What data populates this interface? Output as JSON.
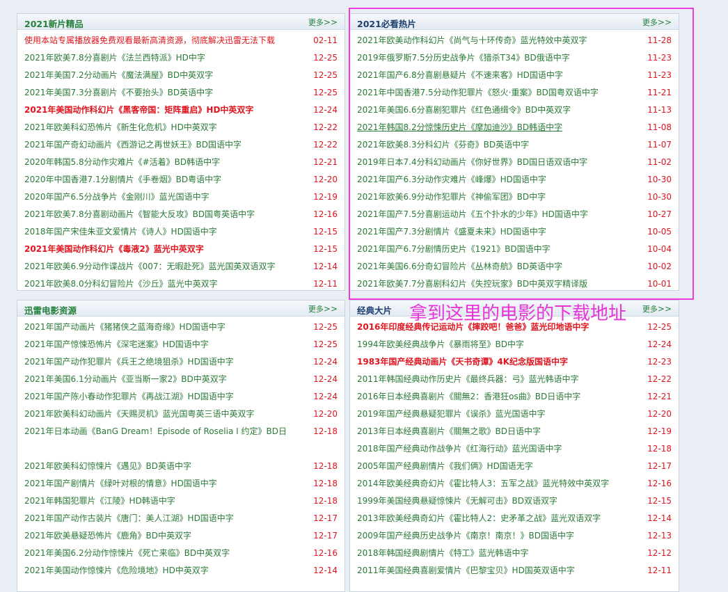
{
  "panels": {
    "new2021": {
      "title": "2021新片精品",
      "more": "更多",
      "items": [
        {
          "t": "使用本站专属播放器免费观看最新高清资源，彻底解决迅雷无法下载",
          "d": "02-11",
          "s": "red"
        },
        {
          "t": "2021年欧美7.8分喜剧片《法兰西特派》HD中字",
          "d": "12-25"
        },
        {
          "t": "2021年美国7.2分动画片《魔法满屋》BD中英双字",
          "d": "12-25"
        },
        {
          "t": "2021年美国7.3分喜剧片《不要抬头》BD英语中字",
          "d": "12-25"
        },
        {
          "t": "2021年美国动作科幻片《黑客帝国：矩阵重启》HD中英双字",
          "d": "12-24",
          "s": "bold"
        },
        {
          "t": "2021年欧美科幻恐怖片《新生化危机》HD中英双字",
          "d": "12-22"
        },
        {
          "t": "2021年国产奇幻动画片《西游记之再世妖王》BD国语中字",
          "d": "12-22"
        },
        {
          "t": "2020年韩国5.8分动作灾难片《#活着》BD韩语中字",
          "d": "12-21"
        },
        {
          "t": "2020年中国香港7.1分剧情片《手卷烟》BD粤语中字",
          "d": "12-20"
        },
        {
          "t": "2020年国产6.5分战争片《金刚川》蓝光国语中字",
          "d": "12-19"
        },
        {
          "t": "2021年欧美7.8分喜剧动画片《智能大反攻》BD国粤英语中字",
          "d": "12-16"
        },
        {
          "t": "2018年国产宋佳朱亚文爱情片《诗人》HD国语中字",
          "d": "12-15"
        },
        {
          "t": "2021年美国动作科幻片《毒液2》蓝光中英双字",
          "d": "12-15",
          "s": "bold"
        },
        {
          "t": "2021年欧美6.9分动作谍战片《007：无暇赴死》蓝光国英双语双字",
          "d": "12-14"
        },
        {
          "t": "2021年欧美8.0分科幻冒险片《沙丘》蓝光中英双字",
          "d": "12-11"
        }
      ]
    },
    "hot2021": {
      "title": "2021必看热片",
      "more": "更多",
      "items": [
        {
          "t": "2021年欧美动作科幻片《尚气与十环传奇》蓝光特效中英双字",
          "d": "11-28"
        },
        {
          "t": "2019年俄罗斯7.5分历史战争片《猎杀T34》BD俄语中字",
          "d": "11-23"
        },
        {
          "t": "2021年国产6.8分喜剧悬疑片《不速来客》HD国语中字",
          "d": "11-23"
        },
        {
          "t": "2021年中国香港7.5分动作犯罪片《怒火·重案》BD国粤双语中字",
          "d": "11-21"
        },
        {
          "t": "2021年美国6.6分喜剧犯罪片《红色通缉令》BD中英双字",
          "d": "11-13"
        },
        {
          "t": "2021年韩国8.2分惊悚历史片《摩加迪沙》BD韩语中字",
          "d": "11-08",
          "s": "u"
        },
        {
          "t": "2021年欧美8.3分科幻片《芬奇》BD英语中字",
          "d": "11-07"
        },
        {
          "t": "2019年日本7.4分科幻动画片《你好世界》BD国日语双语中字",
          "d": "11-02"
        },
        {
          "t": "2021年国产6.3分动作灾难片《峰爆》HD国语中字",
          "d": "10-30"
        },
        {
          "t": "2021年欧美6.9分动作犯罪片《神偷军团》BD中字",
          "d": "10-30"
        },
        {
          "t": "2021年国产7.5分喜剧运动片《五个扑水的少年》HD国语中字",
          "d": "10-27"
        },
        {
          "t": "2021年国产7.3分剧情片《盛夏未来》HD国语中字",
          "d": "10-05"
        },
        {
          "t": "2021年国产6.7分剧情历史片《1921》BD国语中字",
          "d": "10-04"
        },
        {
          "t": "2021年美国6.6分奇幻冒险片《丛林奇航》BD英语中字",
          "d": "10-02"
        },
        {
          "t": "2021年欧美7.7分喜剧科幻片《失控玩家》BD中英双字精译版",
          "d": "10-01"
        }
      ]
    },
    "xunlei": {
      "title": "迅雷电影资源",
      "more": "更多",
      "items": [
        {
          "t": "2021年国产动画片《猪猪侠之蓝海奇缘》HD国语中字",
          "d": "12-25"
        },
        {
          "t": "2021年国产惊悚恐怖片《深宅迷案》HD国语中字",
          "d": "12-25"
        },
        {
          "t": "2021年国产动作犯罪片《兵王之绝境狙杀》HD国语中字",
          "d": "12-24"
        },
        {
          "t": "2021年美国6.1分动画片《亚当斯一家2》BD中英双字",
          "d": "12-24"
        },
        {
          "t": "2021年国产陈小春动作犯罪片《再战江湖》HD国语中字",
          "d": "12-24"
        },
        {
          "t": "2021年欧美科幻动画片《天赐灵机》蓝光国粤英三语中英双字",
          "d": "12-20"
        },
        {
          "t": "2021年日本动画《BanG Dream！Episode of Roselia Ⅰ 约定》BD日",
          "d": "12-18",
          "s": "wrap"
        },
        {
          "t": "2021年欧美科幻惊悚片《遇见》BD英语中字",
          "d": "12-18"
        },
        {
          "t": "2021年国产剧情片《绿叶对根的情意》HD国语中字",
          "d": "12-18"
        },
        {
          "t": "2021年韩国犯罪片《江陵》HD韩语中字",
          "d": "12-18"
        },
        {
          "t": "2021年国产动作古装片《唐门：美人江湖》HD国语中字",
          "d": "12-17"
        },
        {
          "t": "2021年欧美悬疑恐怖片《鹿角》BD中英双字",
          "d": "12-17"
        },
        {
          "t": "2021年美国6.2分动作惊悚片《死亡来临》BD中英双字",
          "d": "12-16"
        },
        {
          "t": "2021年美国动作惊悚片《危险境地》HD中英双字",
          "d": "12-14"
        }
      ]
    },
    "classic": {
      "title": "经典大片",
      "more": "更多",
      "items": [
        {
          "t": "2016年印度经典传记运动片《摔跤吧！爸爸》蓝光印地语中字",
          "d": "12-25",
          "s": "bold"
        },
        {
          "t": "1994年欧美经典战争片《暴雨将至》BD中字",
          "d": "12-24"
        },
        {
          "t": "1983年国产经典动画片《天书奇谭》4K纪念版国语中字",
          "d": "12-23",
          "s": "bold"
        },
        {
          "t": "2011年韩国经典动作历史片《最终兵器：弓》蓝光韩语中字",
          "d": "12-22"
        },
        {
          "t": "2016年日本经典喜剧片《關無2：香港狂os曲》BD日语中字",
          "d": "12-21"
        },
        {
          "t": "2019年国产经典悬疑犯罪片《误杀》蓝光国语中字",
          "d": "12-20"
        },
        {
          "t": "2013年日本经典喜剧片《關無之歌》BD日语中字",
          "d": "12-19"
        },
        {
          "t": "2018年国产经典动作战争片《红海行动》蓝光国语中字",
          "d": "12-18"
        },
        {
          "t": "2005年国产经典剧情片《我们俩》HD国语无字",
          "d": "12-17"
        },
        {
          "t": "2014年欧美经典奇幻片《霍比特人3：五军之战》蓝光特效中英双字",
          "d": "12-16"
        },
        {
          "t": "1999年美国经典悬疑惊悚片《无解可击》BD双语双字",
          "d": "12-15"
        },
        {
          "t": "2013年欧美经典奇幻片《霍比特人2：史矛革之战》蓝光双语双字",
          "d": "12-14"
        },
        {
          "t": "2009年国产经典历史战争片《南京！南京！》BD国语中字",
          "d": "12-13"
        },
        {
          "t": "2018年韩国经典剧情片《特工》蓝光韩语中字",
          "d": "12-12"
        },
        {
          "t": "2011年美国经典喜剧爱情片《巴黎宝贝》HD国英双语中字",
          "d": "12-11"
        }
      ]
    }
  },
  "annotation": "拿到这里的电影的下载地址",
  "colors": {
    "link": "#2a7a37",
    "date": "#e0141e",
    "highlight": "#ef39e1"
  }
}
